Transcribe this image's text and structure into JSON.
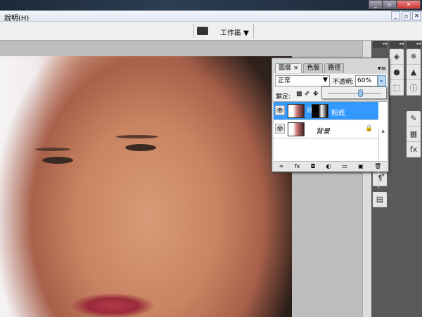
{
  "menubar": {
    "help": "說明(H)"
  },
  "optbar": {
    "workspace": "工作區 ▼"
  },
  "dock": {
    "collapse": "◂◂"
  },
  "layers_panel": {
    "tabs": [
      {
        "label": "圖層 ×"
      },
      {
        "label": "色版"
      },
      {
        "label": "路徑"
      }
    ],
    "menu": "▾≡",
    "blend_mode": "正常",
    "opacity_label": "不透明:",
    "opacity_value": "60%",
    "opacity_fraction": 0.6,
    "lock_label": "鎖定:",
    "layers": [
      {
        "name": "粉底",
        "selected": true
      },
      {
        "name": "背景",
        "locked": true
      }
    ],
    "footer_icons": [
      "link-icon",
      "fx-icon",
      "mask-icon",
      "adjustment-icon",
      "folder-icon",
      "new-layer-icon",
      "trash-icon"
    ]
  }
}
